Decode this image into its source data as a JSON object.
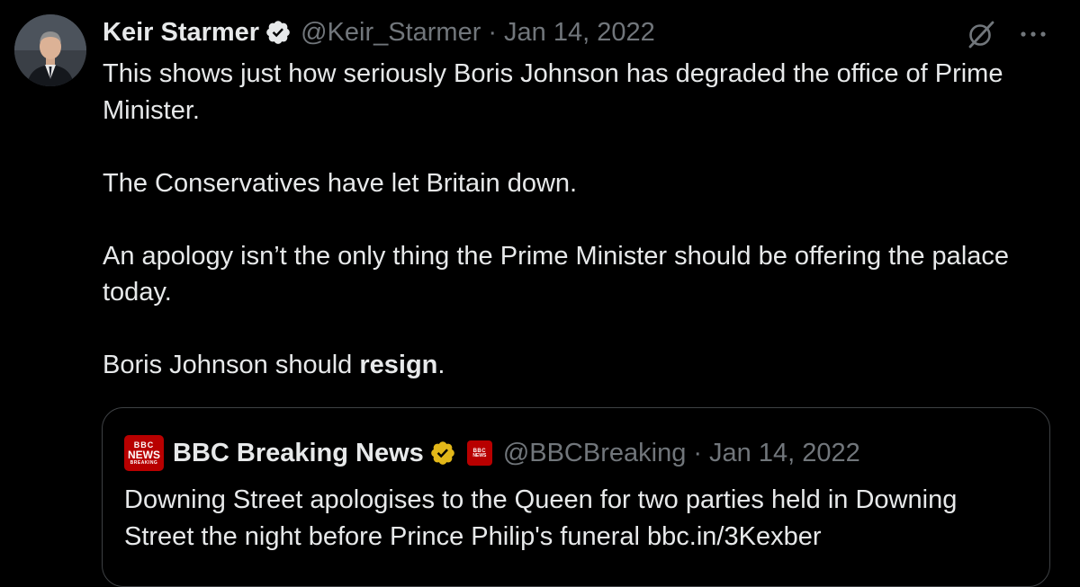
{
  "tweet": {
    "author": {
      "display_name": "Keir Starmer",
      "handle": "@Keir_Starmer",
      "verified": true,
      "verified_color": "#1d9bf0"
    },
    "separator": "·",
    "date": "Jan 14, 2022",
    "text": {
      "p1": "This shows just how seriously Boris Johnson has degraded the office of Prime Minister.",
      "p2": "The Conservatives have let Britain down.",
      "p3": "An apology isn’t the only thing the Prime Minister should be offering the palace today.",
      "p4_before": "Boris Johnson should ",
      "p4_bold": "resign",
      "p4_after": "."
    },
    "actions": {
      "grok_icon": "grok-icon",
      "more_icon": "more-icon"
    }
  },
  "quote": {
    "author": {
      "display_name": "BBC Breaking News",
      "handle": "@BBCBreaking",
      "verified": true,
      "verified_color": "#e2b719",
      "logo": {
        "line1": "BBC",
        "line2": "NEWS",
        "line3": "BREAKING"
      },
      "affiliate_badge": {
        "line1": "BBC",
        "line2": "NEWS"
      },
      "brand_color": "#b80000"
    },
    "separator": "·",
    "date": "Jan 14, 2022",
    "text": "Downing Street apologises to the Queen for two parties held in Downing Street the night before Prince Philip's funeral bbc.in/3Kexber"
  },
  "colors": {
    "background": "#000000",
    "text_primary": "#e7e9ea",
    "text_secondary": "#71767b",
    "border": "#3e4144"
  }
}
